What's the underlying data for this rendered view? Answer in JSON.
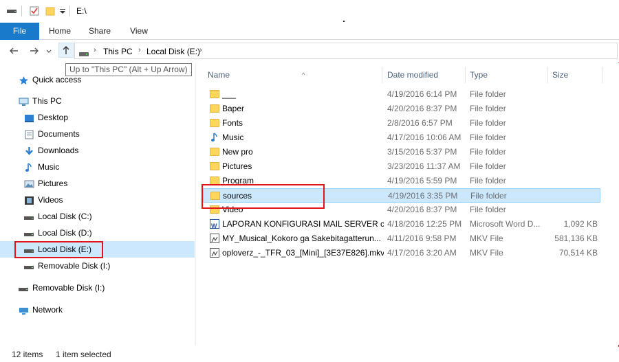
{
  "window": {
    "title": "E:\\",
    "quick_access_icons": [
      "drive-icon",
      "properties-check-icon",
      "new-folder-icon",
      "customize-dropdown-icon"
    ]
  },
  "ribbon": {
    "tabs": [
      {
        "label": "File",
        "active": true
      },
      {
        "label": "Home"
      },
      {
        "label": "Share"
      },
      {
        "label": "View"
      }
    ]
  },
  "navigation": {
    "back_icon": "arrow-left-icon",
    "forward_icon": "arrow-right-icon",
    "recent_icon": "chevron-down-icon",
    "up_icon": "arrow-up-icon",
    "breadcrumb": [
      "This PC",
      "Local Disk (E:)"
    ],
    "tooltip": "Up to \"This PC\" (Alt + Up Arrow)"
  },
  "sidebar": {
    "items": [
      {
        "label": "Quick access",
        "icon": "star-icon"
      },
      {
        "label": "This PC",
        "icon": "computer-icon"
      },
      {
        "label": "Desktop",
        "icon": "desktop-icon"
      },
      {
        "label": "Documents",
        "icon": "documents-icon"
      },
      {
        "label": "Downloads",
        "icon": "download-arrow-icon"
      },
      {
        "label": "Music",
        "icon": "music-note-icon"
      },
      {
        "label": "Pictures",
        "icon": "pictures-icon"
      },
      {
        "label": "Videos",
        "icon": "film-icon"
      },
      {
        "label": "Local Disk (C:)",
        "icon": "drive-icon"
      },
      {
        "label": "Local Disk (D:)",
        "icon": "drive-icon"
      },
      {
        "label": "Local Disk (E:)",
        "icon": "drive-icon",
        "selected": true
      },
      {
        "label": "Removable Disk (I:)",
        "icon": "drive-icon"
      },
      {
        "label": "Removable Disk (I:)",
        "icon": "drive-icon"
      },
      {
        "label": "Network",
        "icon": "network-icon"
      }
    ]
  },
  "filelist": {
    "columns": [
      "Name",
      "Date modified",
      "Type",
      "Size"
    ],
    "rows": [
      {
        "name": "___",
        "date": "4/19/2016 6:14 PM",
        "type": "File folder",
        "size": "",
        "icon": "folder-icon"
      },
      {
        "name": "Baper",
        "date": "4/20/2016 8:37 PM",
        "type": "File folder",
        "size": "",
        "icon": "folder-icon"
      },
      {
        "name": "Fonts",
        "date": "2/8/2016 6:57 PM",
        "type": "File folder",
        "size": "",
        "icon": "folder-icon"
      },
      {
        "name": "Music",
        "date": "4/17/2016 10:06 AM",
        "type": "File folder",
        "size": "",
        "icon": "music-note-icon"
      },
      {
        "name": "New pro",
        "date": "3/15/2016 5:37 PM",
        "type": "File folder",
        "size": "",
        "icon": "folder-icon"
      },
      {
        "name": "Pictures",
        "date": "3/23/2016 11:37 AM",
        "type": "File folder",
        "size": "",
        "icon": "folder-icon"
      },
      {
        "name": "Program",
        "date": "4/19/2016 5:59 PM",
        "type": "File folder",
        "size": "",
        "icon": "folder-icon"
      },
      {
        "name": "sources",
        "date": "4/19/2016 3:35 PM",
        "type": "File folder",
        "size": "",
        "icon": "folder-icon",
        "selected": true
      },
      {
        "name": "Video",
        "date": "4/20/2016 8:37 PM",
        "type": "File folder",
        "size": "",
        "icon": "folder-icon"
      },
      {
        "name": "LAPORAN KONFIGURASI MAIL SERVER c...",
        "date": "4/18/2016 12:25 PM",
        "type": "Microsoft Word D...",
        "size": "1,092 KB",
        "icon": "word-doc-icon"
      },
      {
        "name": "MY_Musical_Kokoro ga Sakebitagatterun...",
        "date": "4/11/2016 9:58 PM",
        "type": "MKV File",
        "size": "581,136 KB",
        "icon": "mkv-file-icon"
      },
      {
        "name": "oploverz_-_TFR_03_[Mini]_[3E37E826].mkv",
        "date": "4/17/2016 3:20 AM",
        "type": "MKV File",
        "size": "70,514 KB",
        "icon": "mkv-file-icon"
      }
    ]
  },
  "statusbar": {
    "item_count": "12 items",
    "selection": "1 item selected"
  },
  "colors": {
    "accent": "#1979ca",
    "selection": "#cce8ff",
    "highlight_box": "#e0131a"
  }
}
